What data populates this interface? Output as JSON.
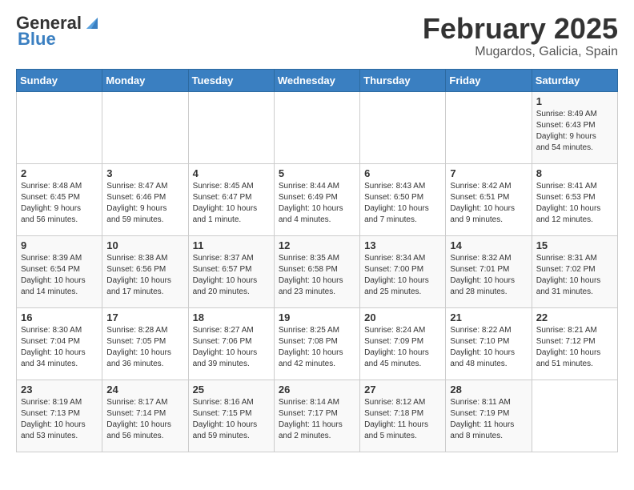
{
  "header": {
    "logo_general": "General",
    "logo_blue": "Blue",
    "month": "February 2025",
    "location": "Mugardos, Galicia, Spain"
  },
  "days_of_week": [
    "Sunday",
    "Monday",
    "Tuesday",
    "Wednesday",
    "Thursday",
    "Friday",
    "Saturday"
  ],
  "weeks": [
    [
      {
        "day": "",
        "info": ""
      },
      {
        "day": "",
        "info": ""
      },
      {
        "day": "",
        "info": ""
      },
      {
        "day": "",
        "info": ""
      },
      {
        "day": "",
        "info": ""
      },
      {
        "day": "",
        "info": ""
      },
      {
        "day": "1",
        "info": "Sunrise: 8:49 AM\nSunset: 6:43 PM\nDaylight: 9 hours\nand 54 minutes."
      }
    ],
    [
      {
        "day": "2",
        "info": "Sunrise: 8:48 AM\nSunset: 6:45 PM\nDaylight: 9 hours\nand 56 minutes."
      },
      {
        "day": "3",
        "info": "Sunrise: 8:47 AM\nSunset: 6:46 PM\nDaylight: 9 hours\nand 59 minutes."
      },
      {
        "day": "4",
        "info": "Sunrise: 8:45 AM\nSunset: 6:47 PM\nDaylight: 10 hours\nand 1 minute."
      },
      {
        "day": "5",
        "info": "Sunrise: 8:44 AM\nSunset: 6:49 PM\nDaylight: 10 hours\nand 4 minutes."
      },
      {
        "day": "6",
        "info": "Sunrise: 8:43 AM\nSunset: 6:50 PM\nDaylight: 10 hours\nand 7 minutes."
      },
      {
        "day": "7",
        "info": "Sunrise: 8:42 AM\nSunset: 6:51 PM\nDaylight: 10 hours\nand 9 minutes."
      },
      {
        "day": "8",
        "info": "Sunrise: 8:41 AM\nSunset: 6:53 PM\nDaylight: 10 hours\nand 12 minutes."
      }
    ],
    [
      {
        "day": "9",
        "info": "Sunrise: 8:39 AM\nSunset: 6:54 PM\nDaylight: 10 hours\nand 14 minutes."
      },
      {
        "day": "10",
        "info": "Sunrise: 8:38 AM\nSunset: 6:56 PM\nDaylight: 10 hours\nand 17 minutes."
      },
      {
        "day": "11",
        "info": "Sunrise: 8:37 AM\nSunset: 6:57 PM\nDaylight: 10 hours\nand 20 minutes."
      },
      {
        "day": "12",
        "info": "Sunrise: 8:35 AM\nSunset: 6:58 PM\nDaylight: 10 hours\nand 23 minutes."
      },
      {
        "day": "13",
        "info": "Sunrise: 8:34 AM\nSunset: 7:00 PM\nDaylight: 10 hours\nand 25 minutes."
      },
      {
        "day": "14",
        "info": "Sunrise: 8:32 AM\nSunset: 7:01 PM\nDaylight: 10 hours\nand 28 minutes."
      },
      {
        "day": "15",
        "info": "Sunrise: 8:31 AM\nSunset: 7:02 PM\nDaylight: 10 hours\nand 31 minutes."
      }
    ],
    [
      {
        "day": "16",
        "info": "Sunrise: 8:30 AM\nSunset: 7:04 PM\nDaylight: 10 hours\nand 34 minutes."
      },
      {
        "day": "17",
        "info": "Sunrise: 8:28 AM\nSunset: 7:05 PM\nDaylight: 10 hours\nand 36 minutes."
      },
      {
        "day": "18",
        "info": "Sunrise: 8:27 AM\nSunset: 7:06 PM\nDaylight: 10 hours\nand 39 minutes."
      },
      {
        "day": "19",
        "info": "Sunrise: 8:25 AM\nSunset: 7:08 PM\nDaylight: 10 hours\nand 42 minutes."
      },
      {
        "day": "20",
        "info": "Sunrise: 8:24 AM\nSunset: 7:09 PM\nDaylight: 10 hours\nand 45 minutes."
      },
      {
        "day": "21",
        "info": "Sunrise: 8:22 AM\nSunset: 7:10 PM\nDaylight: 10 hours\nand 48 minutes."
      },
      {
        "day": "22",
        "info": "Sunrise: 8:21 AM\nSunset: 7:12 PM\nDaylight: 10 hours\nand 51 minutes."
      }
    ],
    [
      {
        "day": "23",
        "info": "Sunrise: 8:19 AM\nSunset: 7:13 PM\nDaylight: 10 hours\nand 53 minutes."
      },
      {
        "day": "24",
        "info": "Sunrise: 8:17 AM\nSunset: 7:14 PM\nDaylight: 10 hours\nand 56 minutes."
      },
      {
        "day": "25",
        "info": "Sunrise: 8:16 AM\nSunset: 7:15 PM\nDaylight: 10 hours\nand 59 minutes."
      },
      {
        "day": "26",
        "info": "Sunrise: 8:14 AM\nSunset: 7:17 PM\nDaylight: 11 hours\nand 2 minutes."
      },
      {
        "day": "27",
        "info": "Sunrise: 8:12 AM\nSunset: 7:18 PM\nDaylight: 11 hours\nand 5 minutes."
      },
      {
        "day": "28",
        "info": "Sunrise: 8:11 AM\nSunset: 7:19 PM\nDaylight: 11 hours\nand 8 minutes."
      },
      {
        "day": "",
        "info": ""
      }
    ]
  ]
}
